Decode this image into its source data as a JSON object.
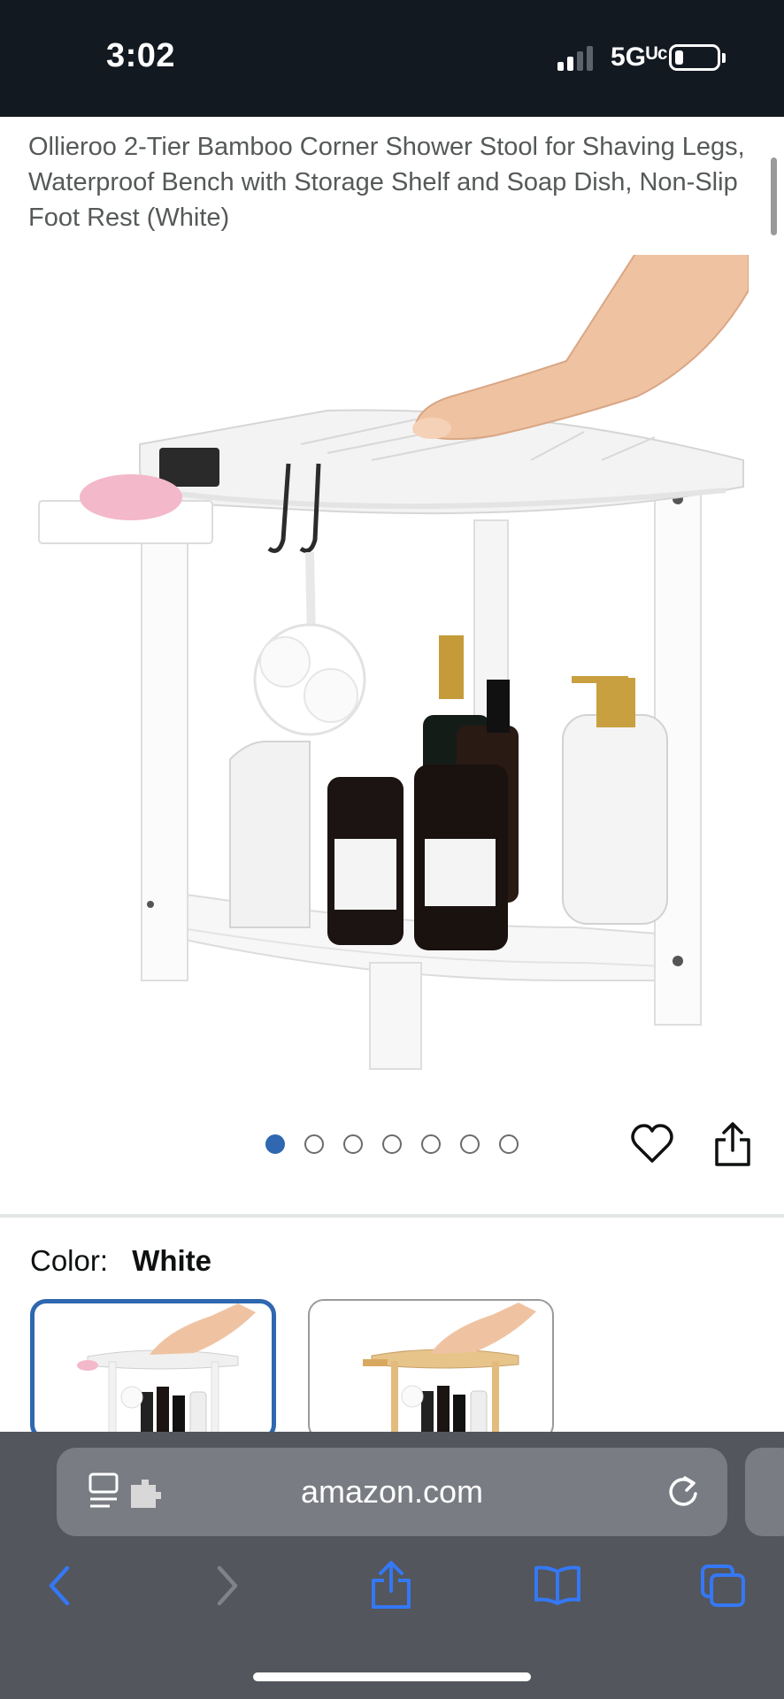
{
  "status_bar": {
    "time": "3:02",
    "network": "5Gᵁᶜ"
  },
  "product": {
    "title": "Ollieroo 2-Tier Bamboo Corner Shower Stool for Shaving Legs, Waterproof Bench with Storage Shelf and Soap Dish, Non-Slip Foot Rest (White)",
    "image_count": 7,
    "active_image": 1
  },
  "color_selector": {
    "label": "Color:",
    "selected": "White"
  },
  "browser": {
    "url": "amazon.com"
  },
  "colors": {
    "status_bg": "#131921",
    "accent": "#2f67b0",
    "toolbar_bg": "#53565c",
    "safari_blue": "#3478f6"
  }
}
